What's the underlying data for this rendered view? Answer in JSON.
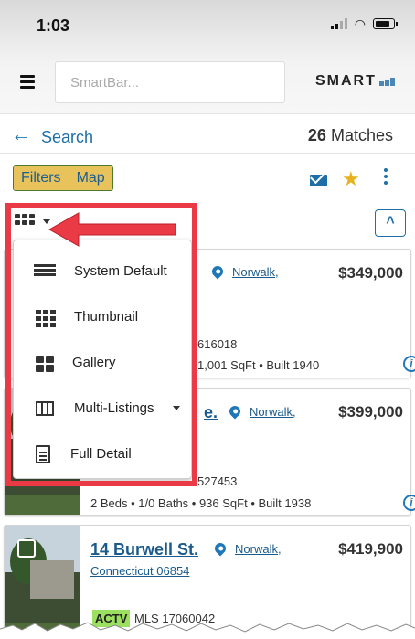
{
  "status_bar": {
    "time": "1:03"
  },
  "header": {
    "smartbar_placeholder": "SmartBar...",
    "logo_text": "SMART"
  },
  "search_row": {
    "back_label": "Search",
    "match_count": "26",
    "match_label": "Matches"
  },
  "toolbar": {
    "filters_label": "Filters",
    "map_label": "Map"
  },
  "view_menu": {
    "items": [
      {
        "label": "System Default",
        "icon": "list-icon"
      },
      {
        "label": "Thumbnail",
        "icon": "thumbnail-grid-icon"
      },
      {
        "label": "Gallery",
        "icon": "gallery-icon"
      },
      {
        "label": "Multi-Listings",
        "icon": "columns-icon"
      },
      {
        "label": "Full Detail",
        "icon": "document-icon"
      }
    ]
  },
  "listings": [
    {
      "address": "",
      "city": "Norwalk,",
      "state_zip": "",
      "price": "$349,000",
      "status": "",
      "mls": "616018",
      "details": "1,001 SqFt • Built 1940"
    },
    {
      "address": "e.",
      "city": "Norwalk,",
      "state_zip": "",
      "price": "$399,000",
      "status": "",
      "mls": "527453",
      "details": "2 Beds • 1/0 Baths • 936 SqFt • Built 1938"
    },
    {
      "address": "14 Burwell St.",
      "city": "Norwalk,",
      "state_zip": "Connecticut 06854",
      "price": "$419,900",
      "status": "ACTV",
      "mls": "MLS 17060042",
      "details": ""
    }
  ],
  "colors": {
    "accent_blue": "#1e6fa8",
    "highlight_red": "#ea3a45",
    "segment_yellow": "#e8c25a",
    "status_green": "#9be05e",
    "star_gold": "#e6b31e"
  }
}
